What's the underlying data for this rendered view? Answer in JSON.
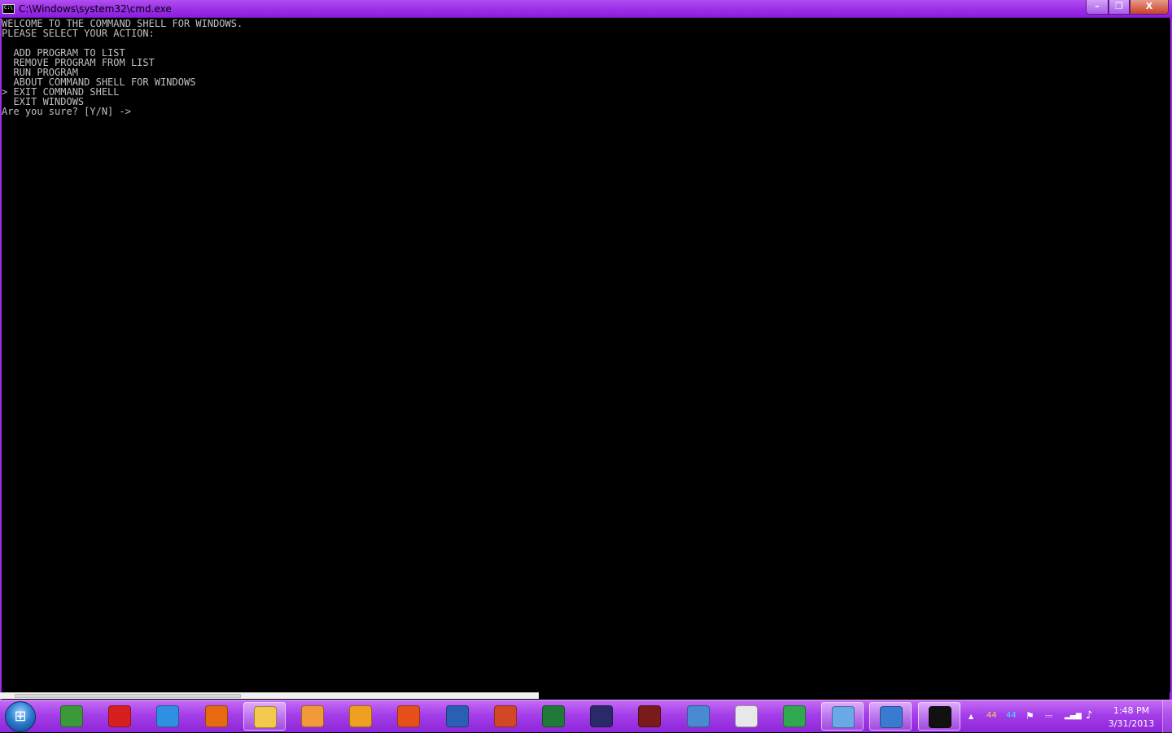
{
  "window": {
    "title": "C:\\Windows\\system32\\cmd.exe",
    "icon_text": "C:\\",
    "min_glyph": "–",
    "max_glyph": "❐",
    "close_glyph": "X"
  },
  "console": {
    "lines": [
      "WELCOME TO THE COMMAND SHELL FOR WINDOWS.",
      "PLEASE SELECT YOUR ACTION:",
      "",
      "  ADD PROGRAM TO LIST",
      "  REMOVE PROGRAM FROM LIST",
      "  RUN PROGRAM",
      "  ABOUT COMMAND SHELL FOR WINDOWS",
      "> EXIT COMMAND SHELL",
      "  EXIT WINDOWS",
      "Are you sure? [Y/N] ->"
    ],
    "text_color": "#c0c0c0",
    "background": "#000000"
  },
  "taskbar": {
    "accent": "#a43ee8",
    "start_icon": "windows-logo-icon",
    "start_glyph": "⊞",
    "items": [
      {
        "name": "computer-monitor-icon",
        "color": "#3a9a3a",
        "active": false
      },
      {
        "name": "app-red-blue-icon",
        "color": "#d62020",
        "active": false
      },
      {
        "name": "internet-explorer-icon",
        "color": "#2f8fe0",
        "active": false
      },
      {
        "name": "firefox-icon",
        "color": "#e86a10",
        "active": false
      },
      {
        "name": "file-explorer-icon",
        "color": "#f2c94c",
        "active": true
      },
      {
        "name": "media-player-icon",
        "color": "#f29a3a",
        "active": false
      },
      {
        "name": "join-me-icon",
        "color": "#f0a020",
        "active": false
      },
      {
        "name": "office-logo-icon",
        "color": "#e8501a",
        "active": false
      },
      {
        "name": "word-icon",
        "color": "#2b5fb4",
        "active": false
      },
      {
        "name": "powerpoint-icon",
        "color": "#d24726",
        "active": false
      },
      {
        "name": "excel-icon",
        "color": "#1f7a3a",
        "active": false
      },
      {
        "name": "headphones-icon",
        "color": "#2a2a6a",
        "active": false
      },
      {
        "name": "film-strip-icon",
        "color": "#7a1a1a",
        "active": false
      },
      {
        "name": "user-worker-icon",
        "color": "#4a8ad0",
        "active": false
      },
      {
        "name": "solitaire-cards-icon",
        "color": "#e8e8e8",
        "active": false
      },
      {
        "name": "chrome-icon",
        "color": "#2fa84f",
        "active": false
      },
      {
        "name": "paint-palette-icon",
        "color": "#6aa8e8",
        "active": true
      },
      {
        "name": "control-panel-icon",
        "color": "#3a7ad0",
        "active": true
      },
      {
        "name": "command-prompt-icon",
        "color": "#111111",
        "active": true
      }
    ]
  },
  "tray": {
    "up_arrow": "▲",
    "indicator_1": "44",
    "indicator_2": "44",
    "flag_glyph": "⚑",
    "signal_glyph": "▂▄▆",
    "speaker_glyph": "♪",
    "time": "1:48 PM",
    "date": "3/31/2013"
  }
}
